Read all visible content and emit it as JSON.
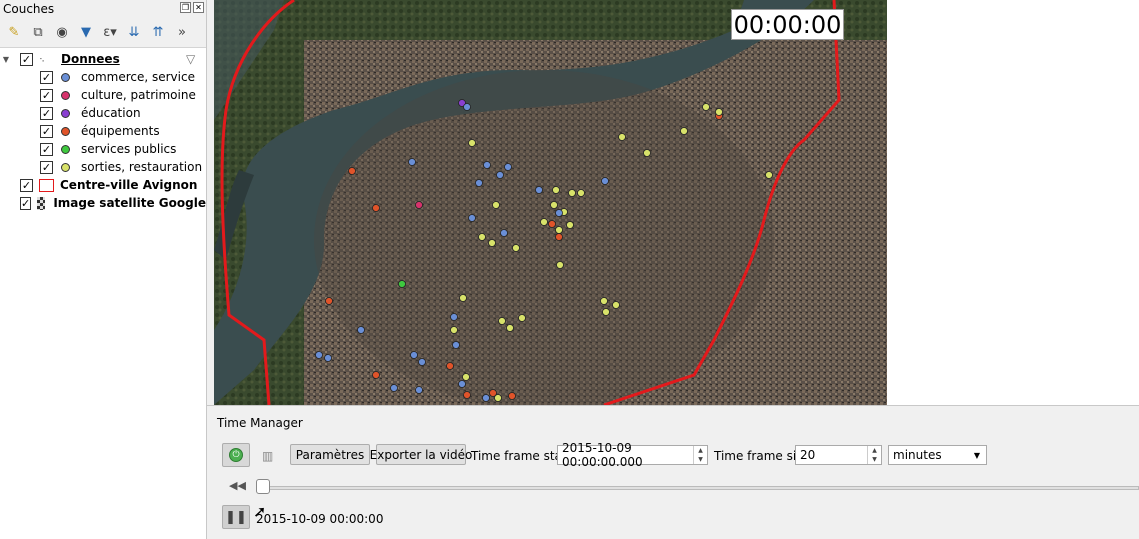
{
  "layers_panel": {
    "title": "Couches",
    "toolbar_icons": [
      "paint-brush-icon",
      "add-group-icon",
      "eye-icon",
      "filter-icon",
      "expression-icon",
      "expand-all-icon",
      "collapse-all-icon",
      "more-icon"
    ],
    "group": {
      "label": "Donnees",
      "checked": true
    },
    "sublayers": [
      {
        "label": "commerce, service",
        "color": "#6a8fd6"
      },
      {
        "label": "culture, patrimoine",
        "color": "#d6336c"
      },
      {
        "label": "éducation",
        "color": "#8a3fd1"
      },
      {
        "label": "équipements",
        "color": "#e0542a"
      },
      {
        "label": "services publics",
        "color": "#3fc93f"
      },
      {
        "label": "sorties, restauration",
        "color": "#d8e26a"
      }
    ],
    "polygon_layer": {
      "label": "Centre-ville Avignon",
      "color": "#e31a1c"
    },
    "raster_layer": {
      "label": "Image satellite Google"
    }
  },
  "map": {
    "clock": "00:00:00",
    "boundary_color": "#e31a1c"
  },
  "time_manager": {
    "title": "Time Manager",
    "settings_label": "Paramètres",
    "export_label": "Exporter la vidéo",
    "frame_start_label": "Time frame start",
    "frame_start_value": "2015-10-09 00:00:00.000",
    "frame_size_label": "Time frame size",
    "frame_size_value": "20",
    "unit_value": "minutes",
    "current_time": "2015-10-09 00:00:00",
    "slider_position": 0
  }
}
